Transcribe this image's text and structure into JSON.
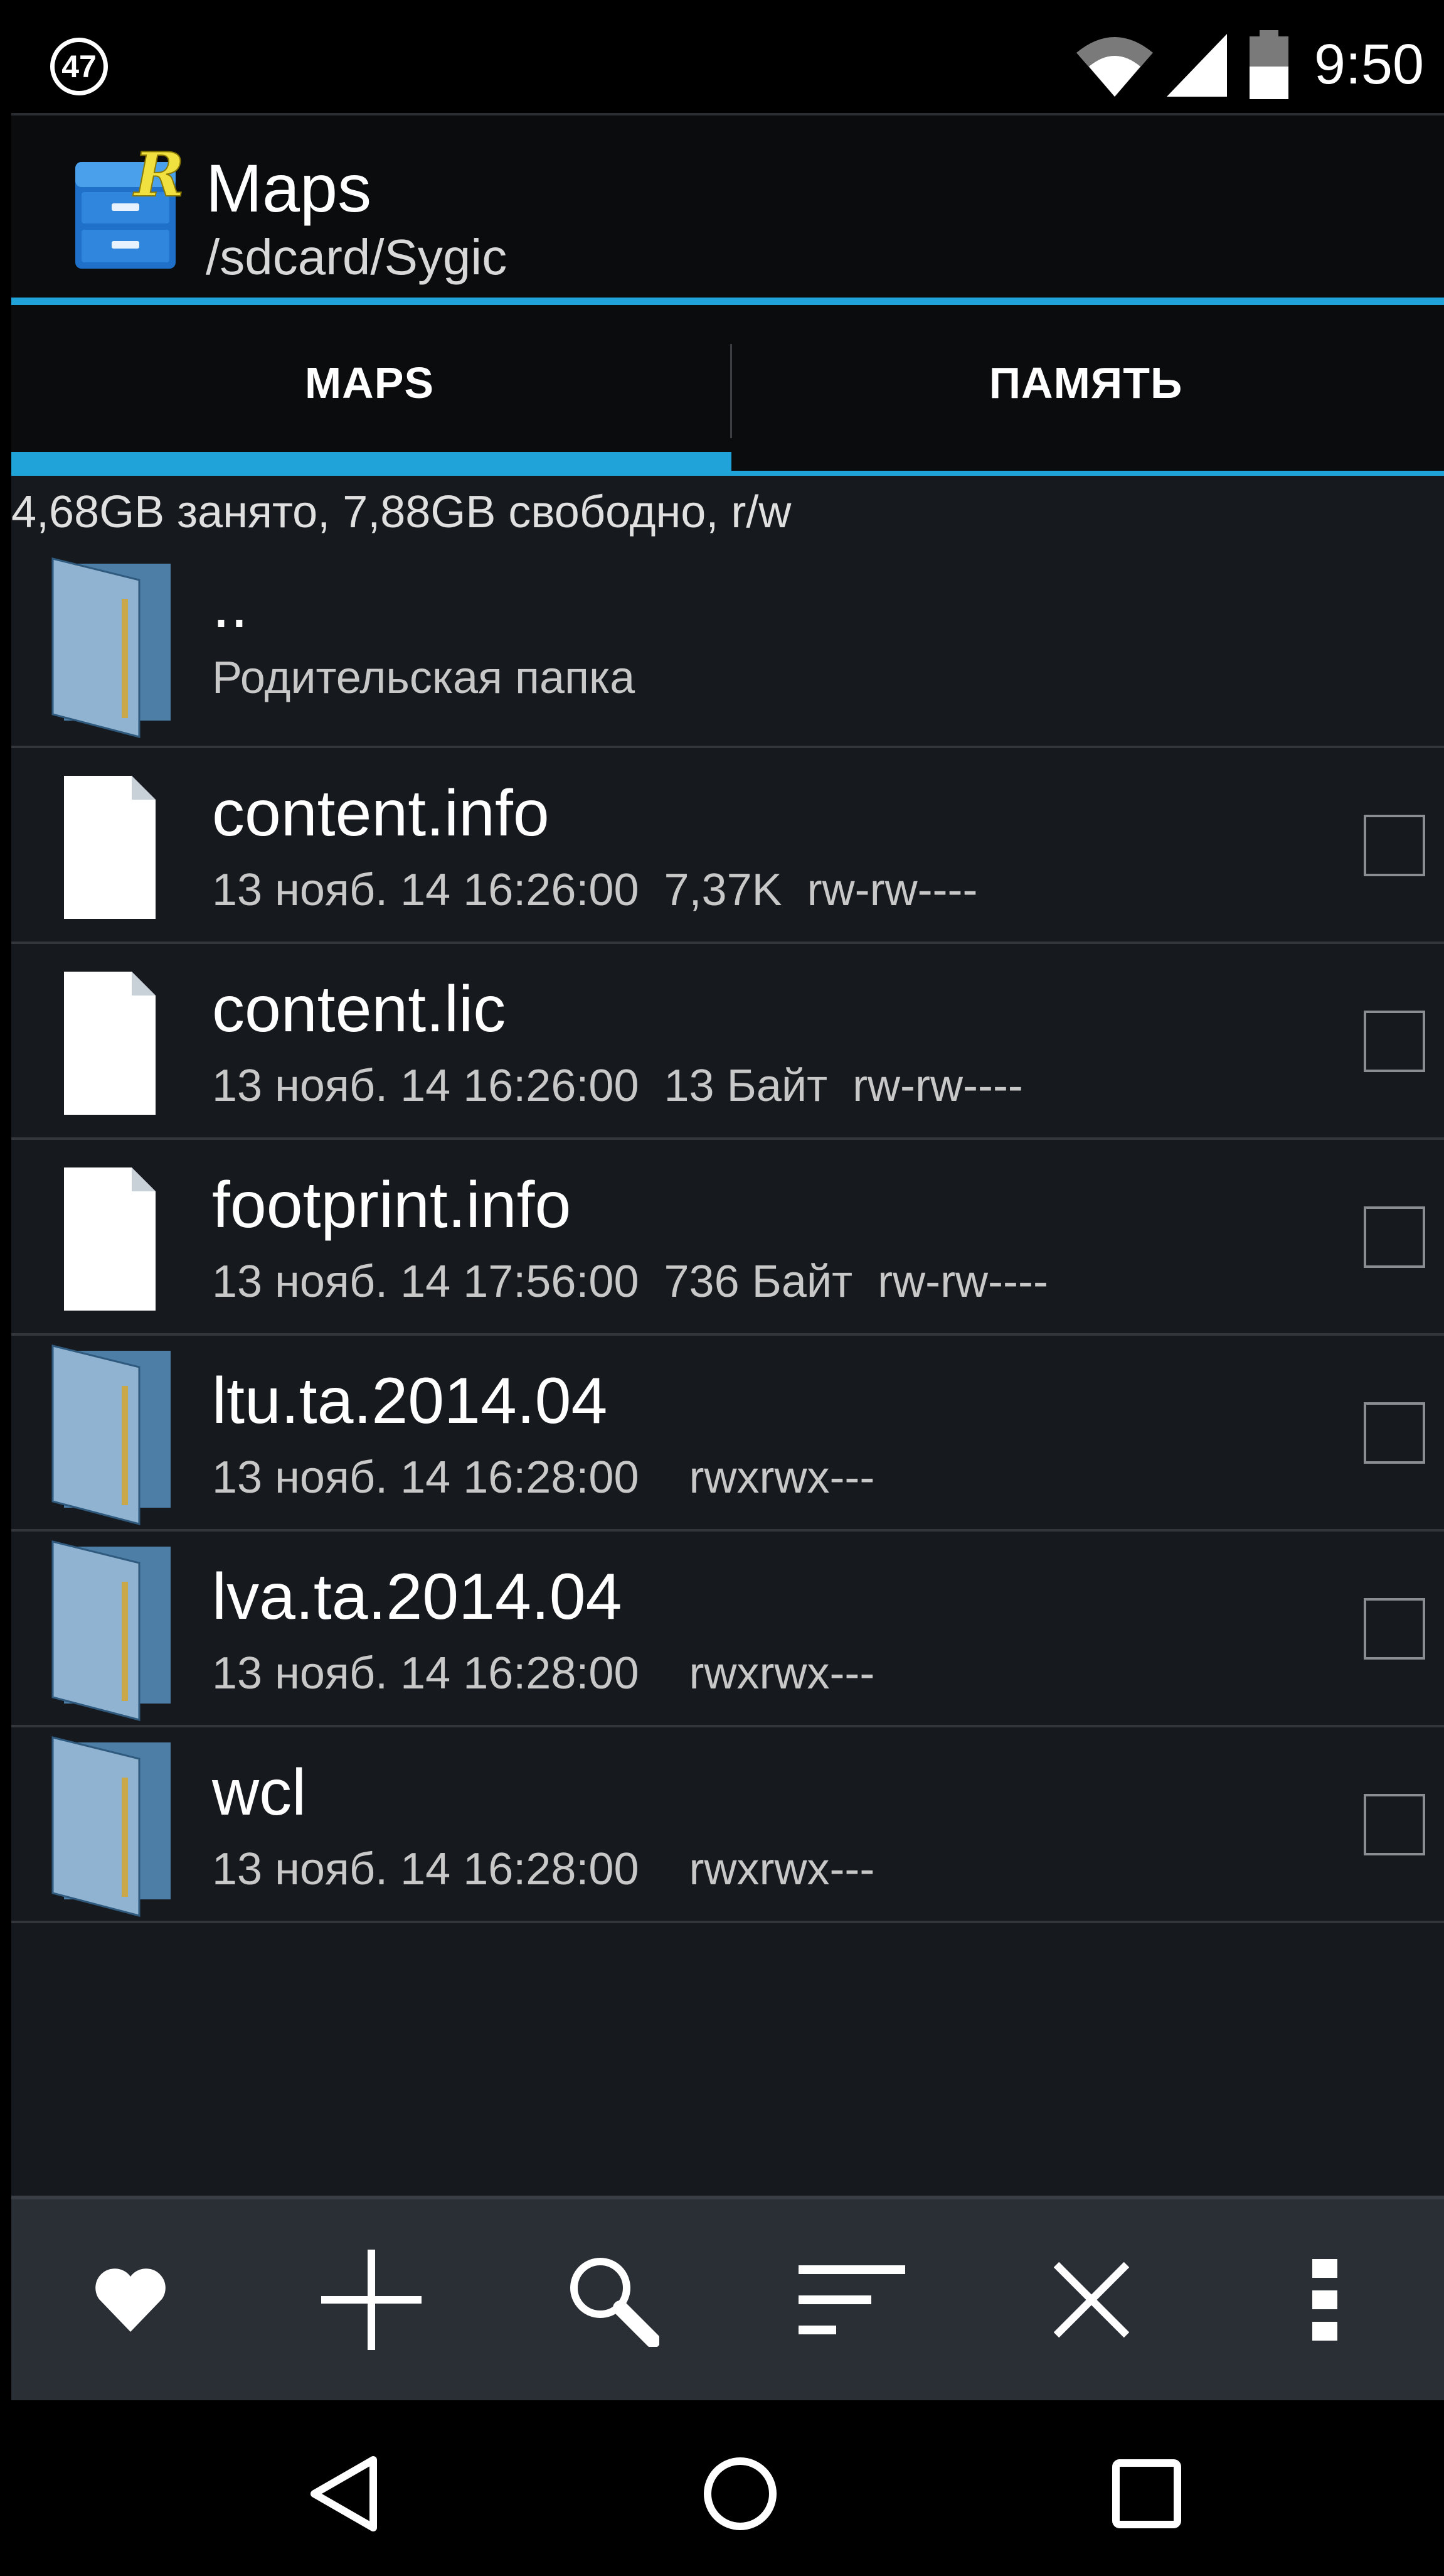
{
  "status_bar": {
    "notification_count": "47",
    "time": "9:50",
    "icons": [
      "wifi-icon",
      "cell-signal-icon",
      "battery-icon"
    ]
  },
  "app_bar": {
    "title": "Maps",
    "path": "/sdcard/Sygic",
    "logo": "file-cabinet-logo"
  },
  "tabs": [
    {
      "label": "MAPS",
      "active": true
    },
    {
      "label": "ПАМЯТЬ",
      "active": false
    }
  ],
  "storage_info": "4,68GB занято, 7,88GB свободно, r/w",
  "colors": {
    "accent": "#1fa3d9",
    "background": "#16191d",
    "toolbar": "#2a2e35"
  },
  "files": [
    {
      "name": "..",
      "meta": "Родительская папка",
      "type": "parent-folder",
      "checkbox": false
    },
    {
      "name": "content.info",
      "meta": "13 нояб. 14 16:26:00  7,37K  rw-rw----",
      "type": "file",
      "checkbox": true
    },
    {
      "name": "content.lic",
      "meta": "13 нояб. 14 16:26:00  13 Байт  rw-rw----",
      "type": "file",
      "checkbox": true
    },
    {
      "name": "footprint.info",
      "meta": "13 нояб. 14 17:56:00  736 Байт  rw-rw----",
      "type": "file",
      "checkbox": true
    },
    {
      "name": "ltu.ta.2014.04",
      "meta": "13 нояб. 14 16:28:00    rwxrwx---",
      "type": "folder",
      "checkbox": true
    },
    {
      "name": "lva.ta.2014.04",
      "meta": "13 нояб. 14 16:28:00    rwxrwx---",
      "type": "folder",
      "checkbox": true
    },
    {
      "name": "wcl",
      "meta": "13 нояб. 14 16:28:00    rwxrwx---",
      "type": "folder",
      "checkbox": true
    }
  ],
  "toolbar": [
    "heart-icon",
    "plus-icon",
    "search-icon",
    "sort-icon",
    "close-icon",
    "overflow-menu-icon"
  ],
  "nav_bar": [
    "back-icon",
    "home-icon",
    "recents-icon"
  ]
}
